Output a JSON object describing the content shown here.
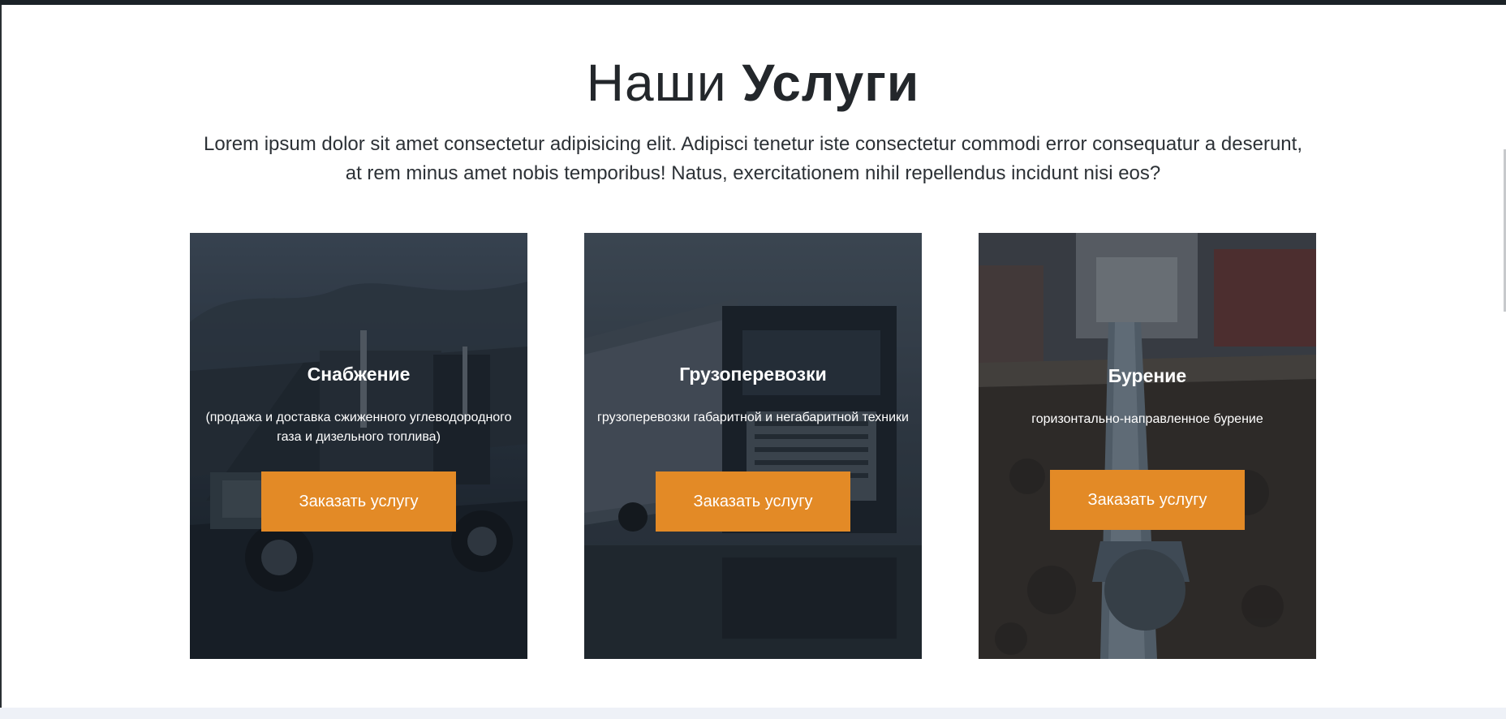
{
  "section": {
    "heading_regular": "Наши",
    "heading_bold": "Услуги",
    "lede": "Lorem ipsum dolor sit amet consectetur adipisicing elit. Adipisci tenetur iste consectetur commodi error consequatur a deserunt, at rem minus amet nobis temporibus! Natus, exercitationem nihil repellendus incidunt nisi eos?"
  },
  "cards": [
    {
      "title": "Снабжение",
      "description": "(продажа и доставка сжиженного углеводородного газа и дизельного топлива)",
      "button_label": "Заказать услугу",
      "image": "fuel-truck-photo"
    },
    {
      "title": "Грузоперевозки",
      "description": "грузоперевозки габаритной и негабаритной техники",
      "button_label": "Заказать услугу",
      "image": "cargo-truck-photo"
    },
    {
      "title": "Бурение",
      "description": "горизонтально-направленное бурение",
      "button_label": "Заказать услугу",
      "image": "drilling-rig-photo"
    }
  ],
  "colors": {
    "accent": "#e38a26",
    "text": "#23272b",
    "card_overlay": "#141b22",
    "bottom_band": "#eef1f7"
  }
}
